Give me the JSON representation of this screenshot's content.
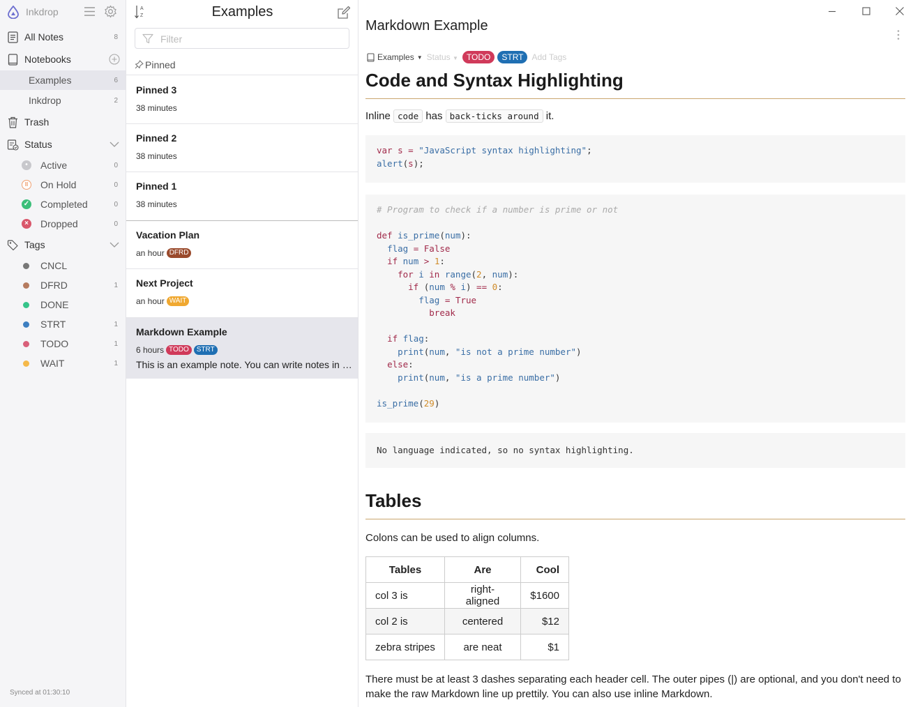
{
  "sidebar": {
    "app_name": "Inkdrop",
    "all_notes": {
      "label": "All Notes",
      "count": "8"
    },
    "notebooks": {
      "label": "Notebooks"
    },
    "notebook_items": [
      {
        "label": "Examples",
        "count": "6"
      },
      {
        "label": "Inkdrop",
        "count": "2"
      }
    ],
    "trash": {
      "label": "Trash"
    },
    "status": {
      "label": "Status",
      "items": [
        {
          "label": "Active",
          "count": "0",
          "color": "#c8c8cc"
        },
        {
          "label": "On Hold",
          "count": "0",
          "color": "#f0a070"
        },
        {
          "label": "Completed",
          "count": "0",
          "color": "#3cbf7a"
        },
        {
          "label": "Dropped",
          "count": "0",
          "color": "#d9576b"
        }
      ]
    },
    "tags": {
      "label": "Tags",
      "items": [
        {
          "label": "CNCL",
          "count": "",
          "color": "#777777"
        },
        {
          "label": "DFRD",
          "count": "1",
          "color": "#b57b5f"
        },
        {
          "label": "DONE",
          "count": "",
          "color": "#35c48a"
        },
        {
          "label": "STRT",
          "count": "1",
          "color": "#3d7fc1"
        },
        {
          "label": "TODO",
          "count": "1",
          "color": "#d9607a"
        },
        {
          "label": "WAIT",
          "count": "1",
          "color": "#f5b94a"
        }
      ]
    },
    "synced": "Synced at 01:30:10"
  },
  "notelist": {
    "title": "Examples",
    "filter_placeholder": "Filter",
    "pinned_label": "Pinned",
    "notes": [
      {
        "title": "Pinned 3",
        "time": "38 minutes"
      },
      {
        "title": "Pinned 2",
        "time": "38 minutes"
      },
      {
        "title": "Pinned 1",
        "time": "38 minutes"
      },
      {
        "title": "Vacation Plan",
        "time": "an hour",
        "tags": [
          {
            "label": "DFRD",
            "color": "#9a4a2c"
          }
        ]
      },
      {
        "title": "Next Project",
        "time": "an hour",
        "tags": [
          {
            "label": "WAIT",
            "color": "#f0a830"
          }
        ]
      },
      {
        "title": "Markdown Example",
        "time": "6 hours",
        "tags": [
          {
            "label": "TODO",
            "color": "#d03a5a"
          },
          {
            "label": "STRT",
            "color": "#1f6fb3"
          }
        ],
        "snippet": "This is an example note. You can write notes in GitHub-flavored Markdown."
      }
    ]
  },
  "editor": {
    "title": "Markdown Example",
    "notebook": "Examples",
    "status": "Status",
    "tags": [
      {
        "label": "TODO",
        "color": "#d03a5a"
      },
      {
        "label": "STRT",
        "color": "#1f6fb3"
      }
    ],
    "add_tags": "Add Tags",
    "content": {
      "h1_code": "Code and Syntax Highlighting",
      "inline_pre": "Inline",
      "inline_code1": "code",
      "inline_mid": "has",
      "inline_code2": "back-ticks around",
      "inline_post": "it.",
      "plain_code": "No language indicated, so no syntax highlighting.",
      "h1_tables": "Tables",
      "tables_intro": "Colons can be used to align columns.",
      "table": {
        "headers": [
          "Tables",
          "Are",
          "Cool"
        ],
        "rows": [
          [
            "col 3 is",
            "right-aligned",
            "$1600"
          ],
          [
            "col 2 is",
            "centered",
            "$12"
          ],
          [
            "zebra stripes",
            "are neat",
            "$1"
          ]
        ]
      },
      "tables_outro": "There must be at least 3 dashes separating each header cell. The outer pipes (|) are optional, and you don't need to make the raw Markdown line up prettily. You can also use inline Markdown."
    }
  }
}
